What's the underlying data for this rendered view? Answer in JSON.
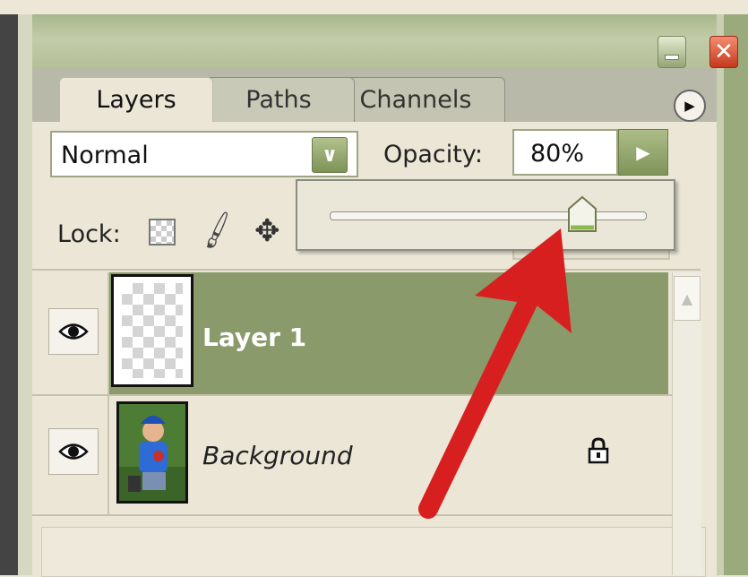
{
  "tabs": {
    "layers": "Layers",
    "paths": "Paths",
    "channels": "Channels"
  },
  "blend_mode": "Normal",
  "opacity": {
    "label": "Opacity:",
    "value": "80%",
    "slider_fraction": 0.8
  },
  "lock_label": "Lock:",
  "layers": [
    {
      "name": "Layer 1",
      "selected": true,
      "visible": true
    },
    {
      "name": "Background",
      "selected": false,
      "visible": true,
      "locked": true
    }
  ],
  "icons": {
    "minimize": "minimize-icon",
    "close": "close-icon",
    "menu": "play-arrow-icon",
    "dropdown": "chevron-down-icon",
    "eye": "eye-icon",
    "lock": "padlock-icon",
    "brush": "brush-icon",
    "move": "move-icon",
    "transparency": "transparency-lock-icon"
  },
  "colors": {
    "selected_row": "#8a9a6a",
    "accent_green": "#7d9356",
    "close_red": "#c5391d",
    "arrow_red": "#d81f1f"
  }
}
